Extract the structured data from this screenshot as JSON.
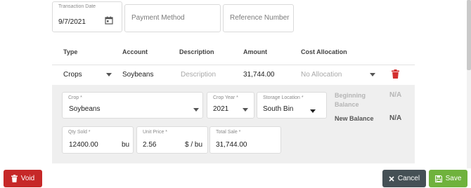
{
  "transaction": {
    "date_label": "Transaction Date",
    "date_value": "9/7/2021",
    "payment_method_placeholder": "Payment Method",
    "reference_number_placeholder": "Reference Number"
  },
  "table": {
    "headers": {
      "type": "Type",
      "account": "Account",
      "description": "Description",
      "amount": "Amount",
      "cost_allocation": "Cost Allocation"
    },
    "row": {
      "type": "Crops",
      "account": "Soybeans",
      "description_placeholder": "Description",
      "amount": "31,744.00",
      "cost_allocation": "No Allocation"
    }
  },
  "detail": {
    "crop": {
      "label": "Crop *",
      "value": "Soybeans"
    },
    "crop_year": {
      "label": "Crop Year *",
      "value": "2021"
    },
    "storage_location": {
      "label": "Storage Location *",
      "value": "South Bin"
    },
    "beginning_balance": {
      "label": "Beginning Balance",
      "value": "N/A"
    },
    "new_balance": {
      "label": "New Balance",
      "value": "N/A"
    },
    "qty_sold": {
      "label": "Qty Sold *",
      "value": "12400.00",
      "unit": "bu"
    },
    "unit_price": {
      "label": "Unit Price *",
      "value": "2.56",
      "unit": "$ / bu"
    },
    "total_sale": {
      "label": "Total Sale *",
      "value": "31,744.00"
    }
  },
  "footer": {
    "void_label": "Void",
    "cancel_label": "Cancel",
    "save_label": "Save"
  },
  "colors": {
    "void": "#c62828",
    "cancel": "#455055",
    "save": "#6fb23c",
    "delete": "#d32f2f"
  },
  "icons": {
    "calendar": "calendar-icon",
    "delete": "trash-icon",
    "void": "trash-icon",
    "cancel": "close-icon",
    "save": "floppy-disk-icon"
  }
}
